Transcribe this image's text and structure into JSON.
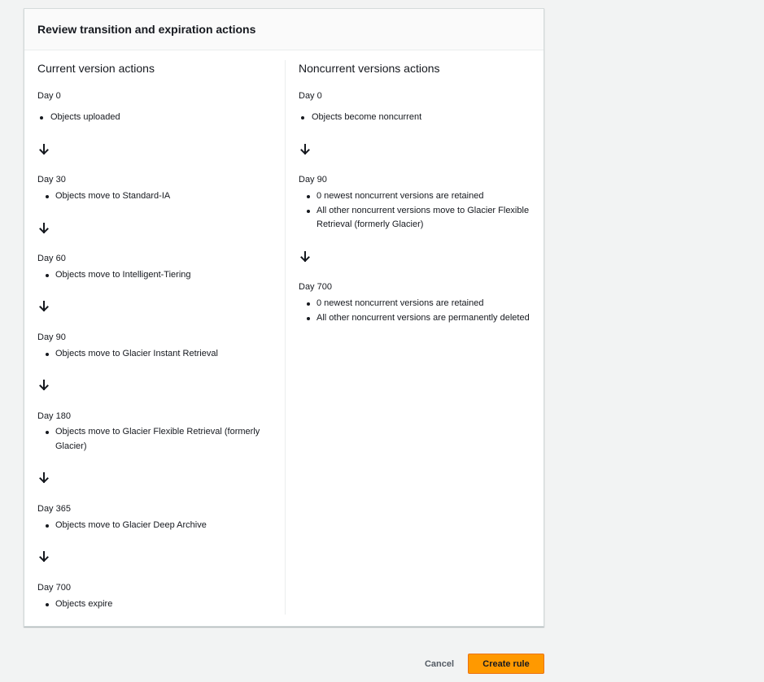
{
  "panel": {
    "title": "Review transition and expiration actions"
  },
  "current": {
    "title": "Current version actions",
    "steps": [
      {
        "day": "Day 0",
        "items": [
          "Objects uploaded"
        ]
      },
      {
        "day": "Day 30",
        "items": [
          "Objects move to Standard-IA"
        ]
      },
      {
        "day": "Day 60",
        "items": [
          "Objects move to Intelligent-Tiering"
        ]
      },
      {
        "day": "Day 90",
        "items": [
          "Objects move to Glacier Instant Retrieval"
        ]
      },
      {
        "day": "Day 180",
        "items": [
          "Objects move to Glacier Flexible Retrieval (formerly Glacier)"
        ]
      },
      {
        "day": "Day 365",
        "items": [
          "Objects move to Glacier Deep Archive"
        ]
      },
      {
        "day": "Day 700",
        "items": [
          "Objects expire"
        ]
      }
    ]
  },
  "noncurrent": {
    "title": "Noncurrent versions actions",
    "steps": [
      {
        "day": "Day 0",
        "items": [
          "Objects become noncurrent"
        ]
      },
      {
        "day": "Day 90",
        "items": [
          "0 newest noncurrent versions are retained",
          "All other noncurrent versions move to Glacier Flexible Retrieval (formerly Glacier)"
        ]
      },
      {
        "day": "Day 700",
        "items": [
          "0 newest noncurrent versions are retained",
          "All other noncurrent versions are permanently deleted"
        ]
      }
    ]
  },
  "footer": {
    "cancel_label": "Cancel",
    "create_label": "Create rule"
  },
  "icons": {
    "arrow": "arrow-down-icon"
  },
  "colors": {
    "primary_button": "#ff9900",
    "page_background": "#f2f3f3"
  }
}
